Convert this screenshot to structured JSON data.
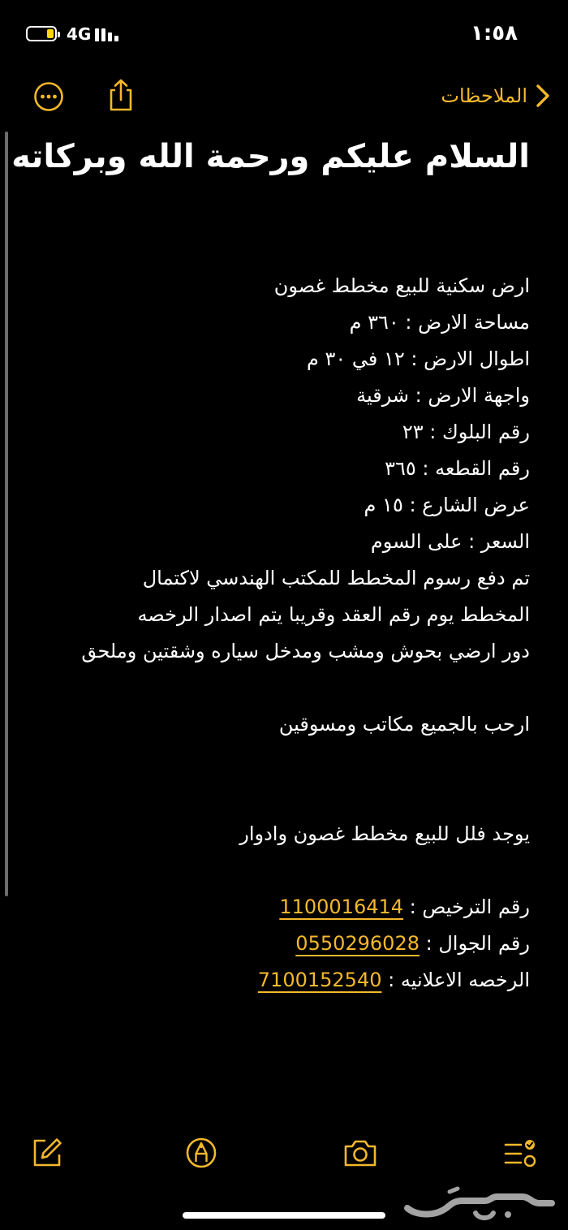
{
  "status_bar": {
    "network": "4G",
    "time": "١:٥٨",
    "battery_level": 0.25
  },
  "nav": {
    "back_label": "الملاحظات",
    "accent_color": "#f3b82b",
    "icons": [
      "more-icon",
      "share-icon",
      "chevron-back-icon"
    ]
  },
  "note": {
    "title": "السلام عليكم ورحمة الله وبركاته",
    "lines": [
      "ارض سكنية للبيع مخطط غصون",
      "مساحة الارض : ٣٦٠ م",
      "اطوال الارض : ١٢ في ٣٠ م",
      "واجهة الارض : شرقية",
      "رقم البلوك : ٢٣",
      "رقم القطعه : ٣٦٥",
      "عرض الشارع : ١٥ م",
      "السعر : على السوم",
      "تم دفع رسوم المخطط للمكتب الهندسي لاكتمال",
      "المخطط يوم رقم العقد وقريبا يتم اصدار الرخصه",
      "دور ارضي بحوش ومشب ومدخل سياره وشقتين وملحق",
      "ارحب بالجميع مكاتب ومسوقين",
      "يوجد فلل للبيع مخطط غصون وادوار"
    ],
    "license_label": "رقم الترخيص :",
    "license_value": "1100016414",
    "mobile_label": "رقم الجوال :",
    "mobile_value": "0550296028",
    "ad_license_label": "الرخصه الاعلانيه :",
    "ad_license_value": "7100152540"
  },
  "toolbar": {
    "icons": [
      "compose-icon",
      "markup-icon",
      "camera-icon",
      "checklist-icon"
    ]
  },
  "watermark": {
    "text": "حراج"
  }
}
